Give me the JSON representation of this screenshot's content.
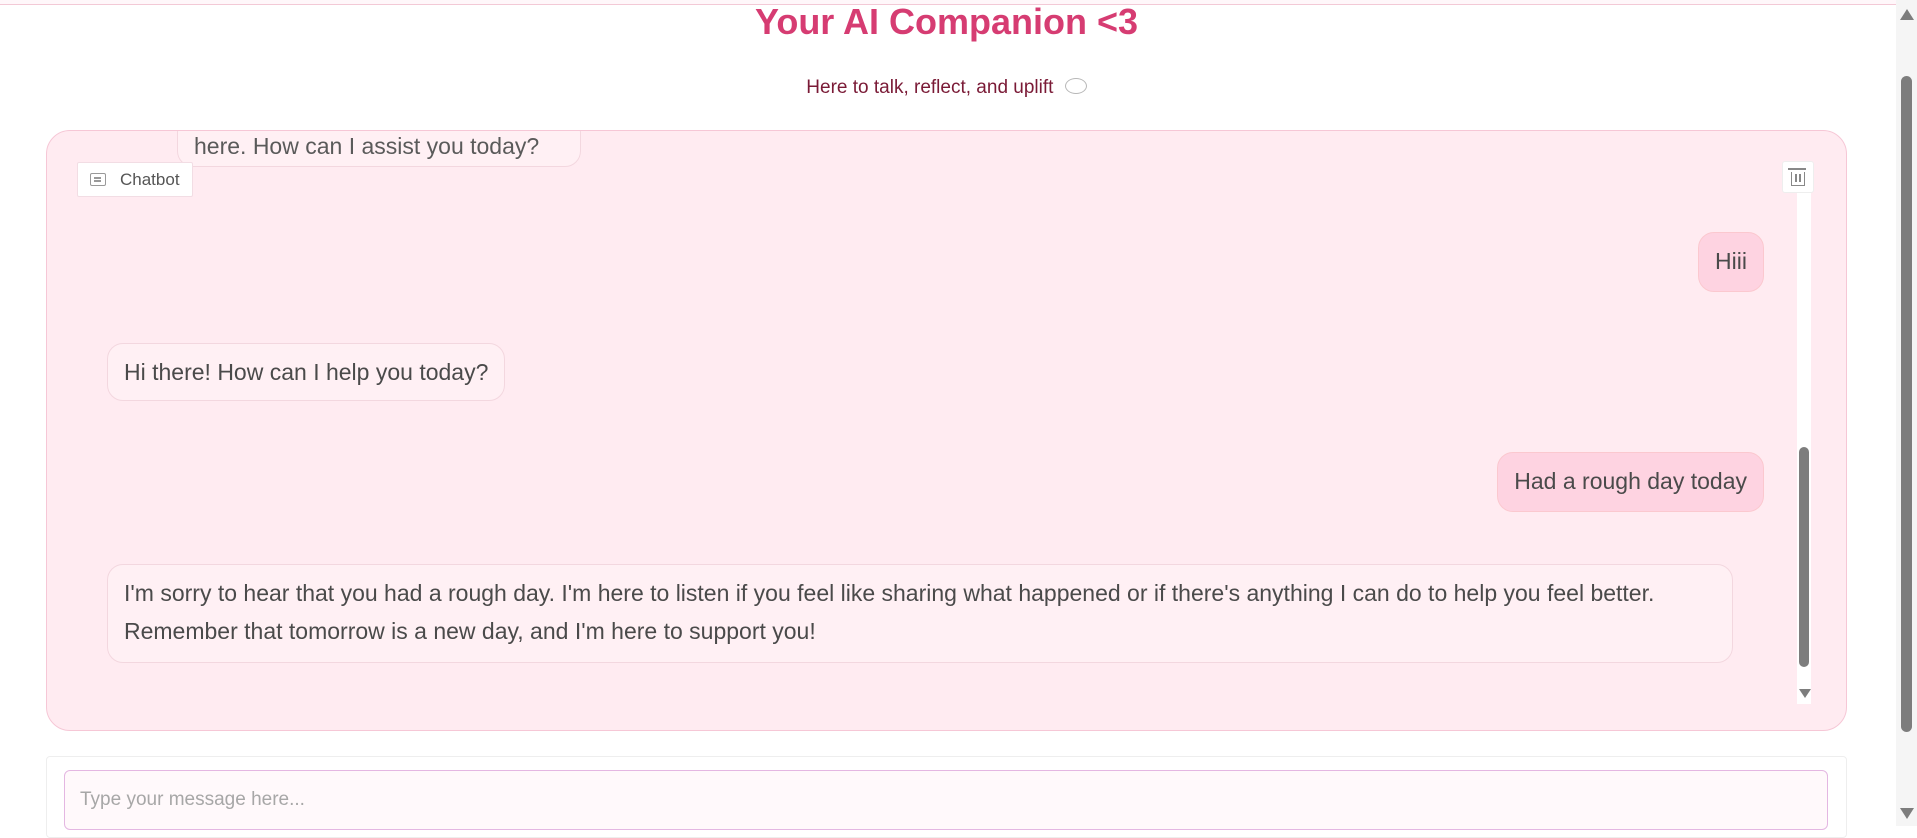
{
  "header": {
    "title": "Your AI Companion <3",
    "subtitle": "Here to talk, reflect, and uplift"
  },
  "chatbot": {
    "label": "Chatbot",
    "messages": [
      {
        "role": "bot",
        "text": "here. How can I assist you today?"
      },
      {
        "role": "user",
        "text": "Hiii"
      },
      {
        "role": "bot",
        "text": "Hi there! How can I help you today?"
      },
      {
        "role": "user",
        "text": "Had a rough day today"
      },
      {
        "role": "bot",
        "text": "I'm sorry to hear that you had a rough day. I'm here to listen if you feel like sharing what happened or if there's anything I can do to help you feel better. Remember that tomorrow is a new day, and I'm here to support you!"
      }
    ]
  },
  "input": {
    "placeholder": "Type your message here...",
    "value": ""
  },
  "colors": {
    "title": "#d63c72",
    "subtitle": "#7a1a36",
    "panel_bg": "#ffebf1",
    "user_bubble": "#fed3e1",
    "bot_bubble": "#fff0f4"
  },
  "icons": {
    "chatbot_label": "chat-icon",
    "clear": "trash-icon",
    "subtitle": "speech-bubble-icon"
  }
}
